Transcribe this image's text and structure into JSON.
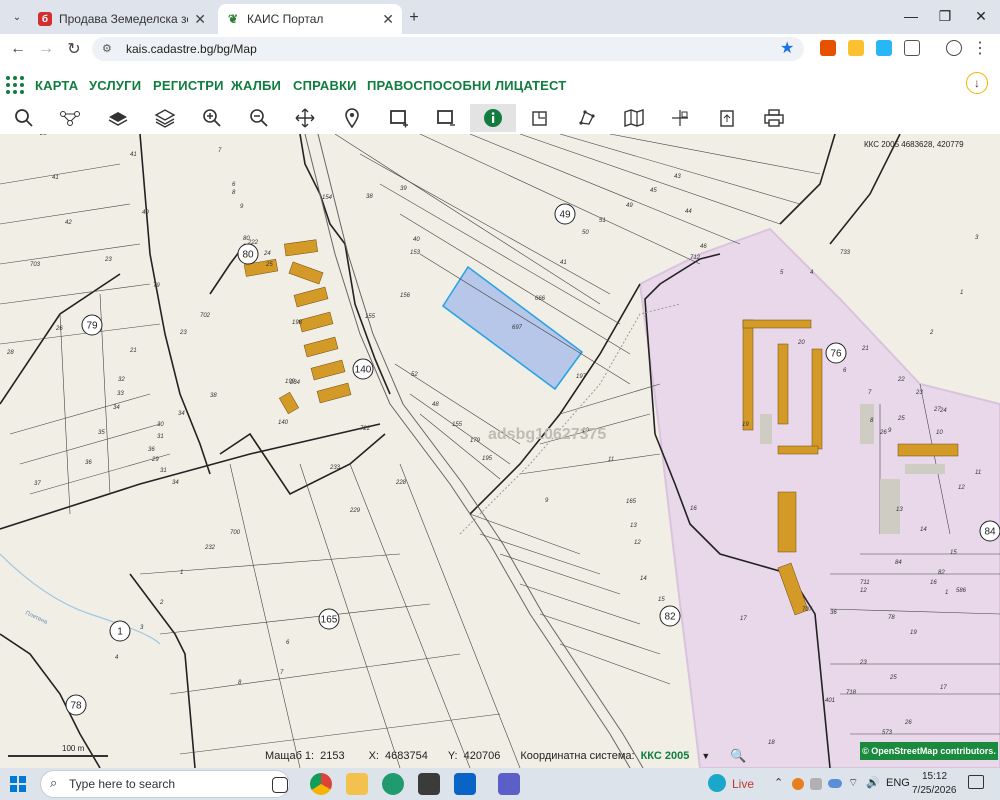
{
  "tabs": [
    {
      "title": "Продава Земеделска земя в С",
      "active": false,
      "favicon_color": "#d32f2f",
      "favicon_glyph": "б"
    },
    {
      "title": "КАИС Портал",
      "active": true,
      "favicon_color": "#2e7d32",
      "favicon_glyph": "❦"
    }
  ],
  "addressbar": {
    "url": "kais.cadastre.bg/bg/Map"
  },
  "menu": {
    "items": [
      "КАРТА",
      "УСЛУГИ",
      "РЕГИСТРИ",
      "ЖАЛБИ",
      "СПРАВКИ",
      "ПРАВОСПОСОБНИ ЛИЦА",
      "ТЕСТ"
    ],
    "accent": "#107d3f"
  },
  "map": {
    "coord_readout": "ККС 2005 4683628, 420779",
    "watermark": "adsbg10627375",
    "scale_label": "100 m",
    "parcel_labels": [
      "25",
      "41",
      "41",
      "7",
      "6",
      "8",
      "9",
      "42",
      "40",
      "703",
      "23",
      "80",
      "222",
      "24",
      "25",
      "79",
      "26",
      "702",
      "28",
      "21",
      "23",
      "32",
      "33",
      "34",
      "35",
      "36",
      "37",
      "38",
      "34",
      "30",
      "31",
      "36",
      "29",
      "31",
      "34",
      "38",
      "39",
      "40",
      "153",
      "154",
      "155",
      "156",
      "666",
      "697",
      "41",
      "45",
      "44",
      "46",
      "43",
      "49",
      "51",
      "50",
      "52",
      "48",
      "155",
      "179",
      "195",
      "196",
      "197",
      "198",
      "199",
      "140",
      "722",
      "233",
      "234",
      "228",
      "229",
      "700",
      "232",
      "1",
      "2",
      "3",
      "4",
      "5",
      "6",
      "7",
      "8",
      "9",
      "10",
      "11",
      "165",
      "13",
      "12",
      "14",
      "15",
      "16",
      "17",
      "18",
      "19",
      "20",
      "21",
      "22",
      "23",
      "24",
      "25",
      "26",
      "27",
      "1",
      "2",
      "3",
      "4",
      "5",
      "6",
      "7",
      "8",
      "9",
      "10",
      "11",
      "12",
      "13",
      "14",
      "15",
      "16",
      "23",
      "25",
      "26",
      "715",
      "718",
      "76",
      "84",
      "78",
      "82",
      "1",
      "36",
      "707",
      "401",
      "711",
      "712",
      "733",
      "573",
      "586",
      "12",
      "17",
      "19"
    ],
    "circle_labels": [
      "80",
      "79",
      "140",
      "49",
      "76",
      "165",
      "82",
      "1",
      "78",
      "84"
    ],
    "road_label": "Плетенa"
  },
  "status": {
    "scale_prefix": "Мащаб 1:",
    "scale_value": "2153",
    "x_prefix": "X:",
    "x_value": "4683754",
    "y_prefix": "Y:",
    "y_value": "420706",
    "crs_prefix": "Координатна система:",
    "crs_value": "ККС 2005"
  },
  "attribution": "© OpenStreetMap contributors.",
  "taskbar": {
    "search_placeholder": "Type here to search",
    "weather": "Live",
    "lang": "ENG",
    "time": "15:12",
    "date": "7/25/2026"
  }
}
